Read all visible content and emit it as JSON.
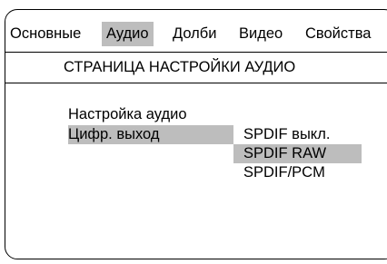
{
  "colors": {
    "selection": "#bdbdbd",
    "border": "#000000",
    "background": "#ffffff"
  },
  "tabs": [
    {
      "label": "Основные",
      "selected": false
    },
    {
      "label": "Аудио",
      "selected": true
    },
    {
      "label": "Долби",
      "selected": false
    },
    {
      "label": "Видео",
      "selected": false
    },
    {
      "label": "Свойства",
      "selected": false
    }
  ],
  "page_title": "СТРАНИЦА НАСТРОЙКИ АУДИО",
  "menu": {
    "heading": "Настройка аудио",
    "items": [
      {
        "label": "Цифр. выход",
        "selected": true
      }
    ]
  },
  "options": [
    {
      "label": "SPDIF выкл.",
      "highlighted": false
    },
    {
      "label": "SPDIF RAW",
      "highlighted": true
    },
    {
      "label": "SPDIF/PCM",
      "highlighted": false
    }
  ]
}
